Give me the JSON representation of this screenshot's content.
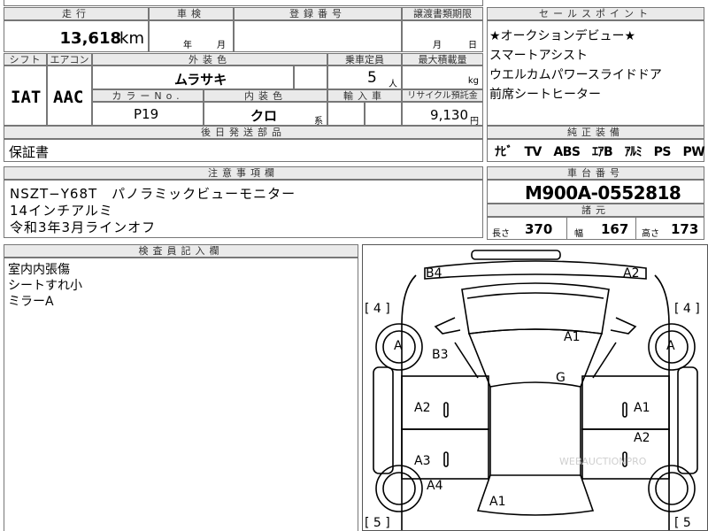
{
  "top": {
    "mileage_label": "走行",
    "mileage_value": "13,618",
    "mileage_unit": "km",
    "inspection_label": "車検",
    "inspection_year": "年",
    "inspection_month": "月",
    "registration_label": "登録番号",
    "transfer_label": "譲渡書類期限",
    "transfer_month": "月",
    "transfer_day": "日"
  },
  "row2": {
    "shift_label": "シフト",
    "aircon_label": "エアコン",
    "exterior_label": "外装色",
    "capacity_label": "乗車定員",
    "loadcap_label": "最大積載量",
    "shift_value": "IAT",
    "aircon_value": "AAC",
    "exterior_value": "ムラサキ",
    "capacity_value": "5",
    "capacity_unit": "人",
    "load_unit": "kg",
    "color_no_label": "カラーNo.",
    "interior_label": "内装色",
    "import_label": "輸入車",
    "recycle_label": "リサイクル預託金",
    "color_no_value": "P19",
    "interior_value": "クロ",
    "interior_suffix": "系",
    "recycle_value": "9,130",
    "recycle_unit": "円"
  },
  "later_parts": {
    "label": "後日発送部品",
    "value": "保証書"
  },
  "notes": {
    "label": "注意事項欄",
    "lines": [
      "NSZT−Y68T　パノラミックビューモニター",
      "14インチアルミ",
      "令和3年3月ラインオフ"
    ]
  },
  "inspector": {
    "label": "検査員記入欄",
    "lines": [
      "室内内張傷",
      "シートすれ小",
      "ミラーA"
    ]
  },
  "sales": {
    "label": "セールスポイント",
    "lines": [
      "★オークションデビュー★",
      "スマートアシスト",
      "ウエルカムパワースライドドア",
      "前席シートヒーター"
    ]
  },
  "equipment": {
    "label": "純正装備",
    "value": "ﾅﾋﾞ　TV　ABS　ｴｱB　ｱﾙﾐ　PS　PW"
  },
  "chassis": {
    "label": "車台番号",
    "value": "M900A-0552818"
  },
  "specs": {
    "label": "諸元",
    "length_label": "長さ",
    "length_value": "370",
    "width_label": "幅",
    "width_value": "167",
    "height_label": "高さ",
    "height_value": "173"
  },
  "diagram": {
    "marks": [
      {
        "id": "b4",
        "text": "B4"
      },
      {
        "id": "a2-top",
        "text": "A2"
      },
      {
        "id": "tire-fl",
        "text": "[ 4 ]"
      },
      {
        "id": "tire-fr",
        "text": "[ 4 ]"
      },
      {
        "id": "a-left",
        "text": "A"
      },
      {
        "id": "a-right",
        "text": "A"
      },
      {
        "id": "a1-hood",
        "text": "A1"
      },
      {
        "id": "b3",
        "text": "B3"
      },
      {
        "id": "g",
        "text": "G"
      },
      {
        "id": "a2-left",
        "text": "A2"
      },
      {
        "id": "a1-right",
        "text": "A1"
      },
      {
        "id": "a2-right",
        "text": "A2"
      },
      {
        "id": "a3",
        "text": "A3"
      },
      {
        "id": "a4",
        "text": "A4"
      },
      {
        "id": "a1-rear",
        "text": "A1"
      },
      {
        "id": "tire-rl",
        "text": "[ 5 ]"
      },
      {
        "id": "tire-rr",
        "text": "[ 5"
      }
    ],
    "watermark": "WEBAUCTIONPRO"
  }
}
